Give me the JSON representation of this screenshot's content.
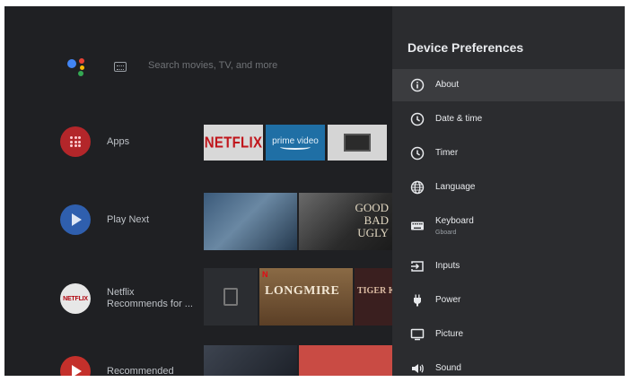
{
  "home": {
    "search_placeholder": "Search movies, TV, and more",
    "rows": [
      {
        "label": "Apps"
      },
      {
        "label": "Play Next"
      },
      {
        "label": "Netflix\nRecommends for ...",
        "icon_text": "NETFLIX"
      },
      {
        "label": "Recommended"
      }
    ],
    "apps_tiles": {
      "netflix": "NETFLIX",
      "prime": "prime video"
    },
    "play_next_tile_text": "GOOD\nBAD\nUGLY",
    "netflix_row_tiles": {
      "longmire_badge": "N",
      "longmire": "LONGMIRE",
      "third": "TIGER KIN"
    }
  },
  "panel": {
    "title": "Device Preferences",
    "items": [
      {
        "label": "About",
        "icon": "info-icon",
        "selected": true
      },
      {
        "label": "Date & time",
        "icon": "clock-icon"
      },
      {
        "label": "Timer",
        "icon": "timer-icon"
      },
      {
        "label": "Language",
        "icon": "globe-icon"
      },
      {
        "label": "Keyboard",
        "sublabel": "Gboard",
        "icon": "keyboard-icon"
      },
      {
        "label": "Inputs",
        "icon": "input-icon"
      },
      {
        "label": "Power",
        "icon": "power-plug-icon"
      },
      {
        "label": "Picture",
        "icon": "monitor-icon"
      },
      {
        "label": "Sound",
        "icon": "speaker-icon"
      }
    ]
  },
  "colors": {
    "screen_bg": "#202124",
    "panel_bg": "#2b2c2f",
    "selected_bg": "#3b3c3f",
    "netflix_red": "#c0151b",
    "prime_blue": "#1f6fa5",
    "google_blue": "#4285f4",
    "google_red": "#ea4335",
    "google_yellow": "#fbbc05",
    "google_green": "#34a853"
  }
}
